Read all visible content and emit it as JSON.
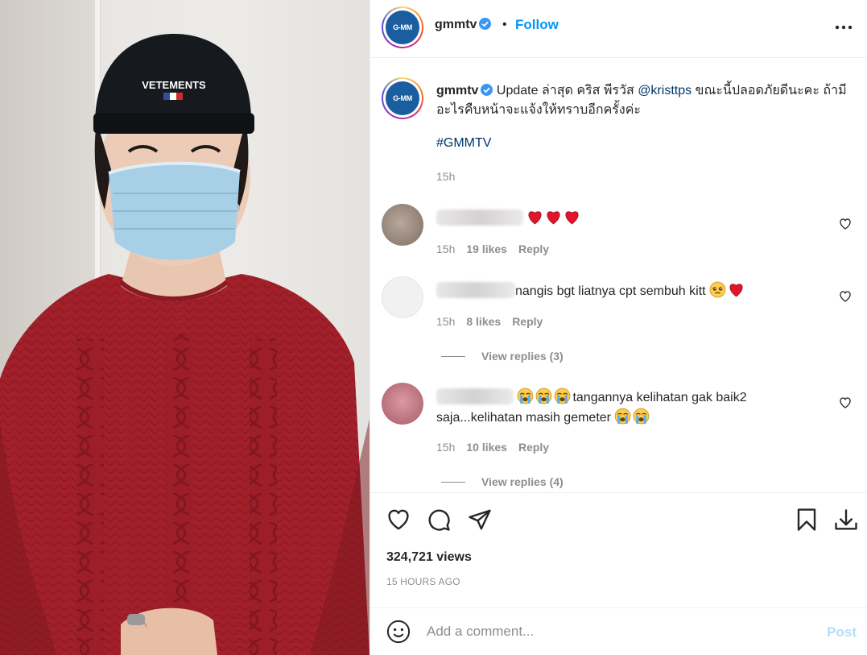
{
  "post": {
    "username": "gmmtv",
    "avatar_text": "G-MM",
    "follow_label": "Follow",
    "separator": "•",
    "caption_prefix": "Update ล่าสุด คริส พีรวัส ",
    "caption_mention": "@kristtps",
    "caption_suffix": " ขณะนี้ปลอดภัยดีนะคะ ถ้ามีอะไรคืบหน้าจะแจ้งให้ทราบอีกครั้งค่ะ",
    "hashtag": "#GMMTV",
    "caption_time": "15h"
  },
  "comments": [
    {
      "text": "",
      "emojis_after": [
        "heart",
        "heart",
        "heart"
      ],
      "time": "15h",
      "likes": "19 likes",
      "reply_label": "Reply",
      "avatar_color": "#9a8a80"
    },
    {
      "text": "nangis bgt liatnya cpt sembuh kitt",
      "emojis_after": [
        "pleading-face",
        "heart"
      ],
      "time": "15h",
      "likes": "8 likes",
      "reply_label": "Reply",
      "view_replies": "View replies (3)",
      "avatar_color": "#e6e6e6"
    },
    {
      "emojis_before": [
        "crying-face",
        "crying-face",
        "crying-face"
      ],
      "text_line1": "tangannya kelihatan gak baik2",
      "text_line2": "saja...kelihatan masih gemeter",
      "emojis_end": [
        "crying-face",
        "crying-face"
      ],
      "time": "15h",
      "likes": "10 likes",
      "reply_label": "Reply",
      "view_replies": "View replies (4)",
      "avatar_color": "#c9848f"
    }
  ],
  "actions": {
    "views": "324,721 views",
    "time_ago": "15 HOURS AGO"
  },
  "add_comment": {
    "placeholder": "Add a comment...",
    "post_label": "Post"
  },
  "colors": {
    "link_blue": "#0095f6",
    "tag_blue": "#00376b",
    "muted": "#8e8e8e",
    "sweater_red": "#a3202b",
    "post_disabled": "#b2dffc"
  }
}
